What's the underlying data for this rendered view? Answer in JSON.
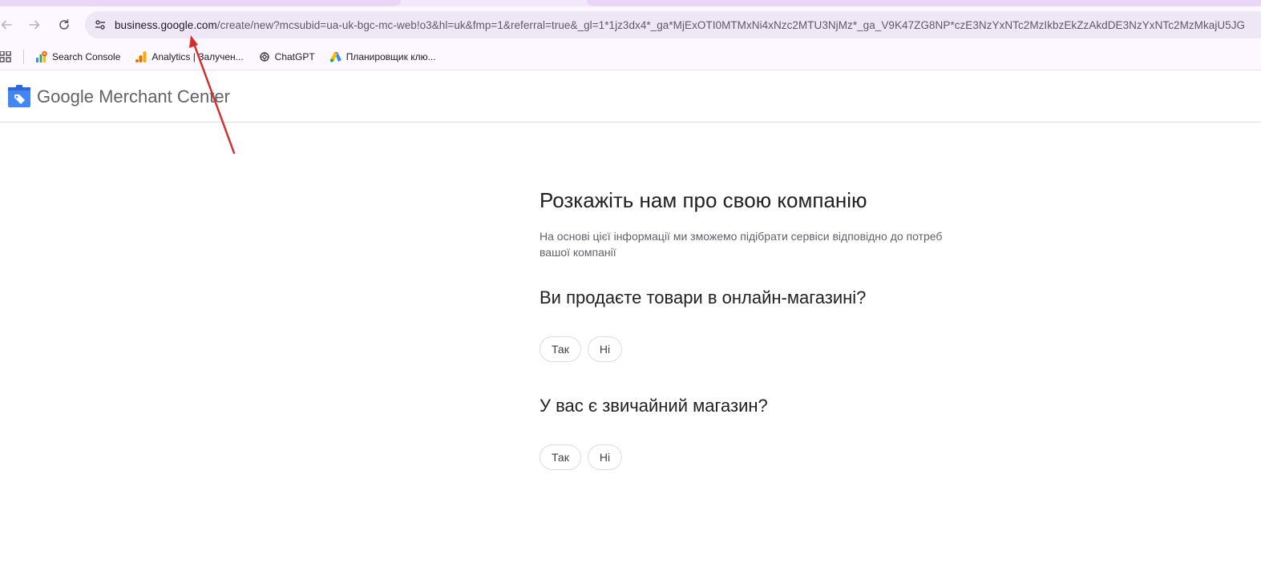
{
  "browser": {
    "url_domain": "business.google.com",
    "url_rest": "/create/new?mcsubid=ua-uk-bgc-mc-web!o3&hl=uk&fmp=1&referral=true&_gl=1*1jz3dx4*_ga*MjExOTI0MTMxNi4xNzc2MTU3NjMz*_ga_V9K47ZG8NP*czE3NzYxNTc2MzIkbzEkZzAkdDE3NzYxNTc2MzMkajU5JG",
    "bookmarks": [
      {
        "label": "Search Console",
        "icon": "search-console-icon"
      },
      {
        "label": "Analytics | Залучен...",
        "icon": "analytics-icon"
      },
      {
        "label": "ChatGPT",
        "icon": "chatgpt-icon"
      },
      {
        "label": "Планировщик клю...",
        "icon": "google-ads-icon"
      }
    ]
  },
  "app": {
    "logo_google": "Google",
    "logo_product": "Merchant Center"
  },
  "main": {
    "heading": "Розкажіть нам про свою компанію",
    "subtitle": "На основі цієї інформації ми зможемо підібрати сервіси відповідно до потреб вашої компанії",
    "questions": [
      {
        "text": "Ви продаєте товари в онлайн-магазині?",
        "options": [
          "Так",
          "Ні"
        ]
      },
      {
        "text": "У вас є звичайний магазин?",
        "options": [
          "Так",
          "Ні"
        ]
      }
    ]
  },
  "colors": {
    "annotation_arrow": "#d32f2f",
    "logo_blue": "#4285f4"
  }
}
